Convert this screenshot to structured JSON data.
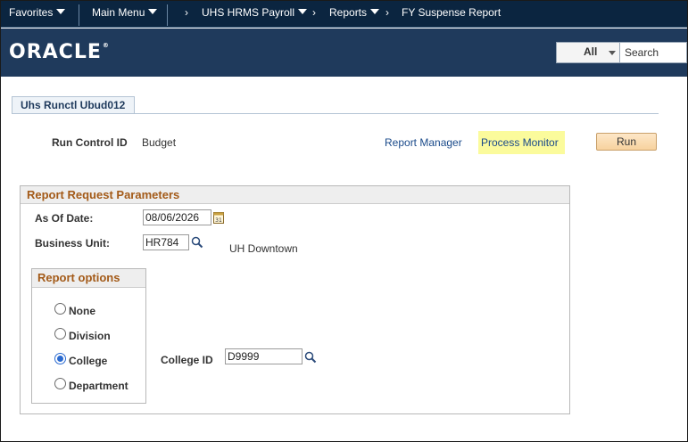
{
  "nav": {
    "favorites": "Favorites",
    "main_menu": "Main Menu",
    "crumbs": [
      "UHS HRMS Payroll",
      "Reports",
      "FY Suspense Report"
    ]
  },
  "header": {
    "logo": "ORACLE",
    "search_scope": "All",
    "search_placeholder": "Search"
  },
  "page": {
    "tab_label": "Uhs Runctl Ubud012",
    "run_control_label": "Run Control ID",
    "run_control_value": "Budget",
    "report_manager": "Report Manager",
    "process_monitor": "Process Monitor",
    "run_button": "Run"
  },
  "params": {
    "title": "Report Request Parameters",
    "as_of_date_label": "As Of Date:",
    "as_of_date_value": "08/06/2026",
    "business_unit_label": "Business Unit:",
    "business_unit_value": "HR784",
    "business_unit_desc": "UH Downtown",
    "college_id_label": "College ID",
    "college_id_value": "D9999"
  },
  "report_options": {
    "title": "Report options",
    "options": [
      {
        "label": "None",
        "checked": false
      },
      {
        "label": "Division",
        "checked": false
      },
      {
        "label": "College",
        "checked": true
      },
      {
        "label": "Department",
        "checked": false
      }
    ]
  }
}
